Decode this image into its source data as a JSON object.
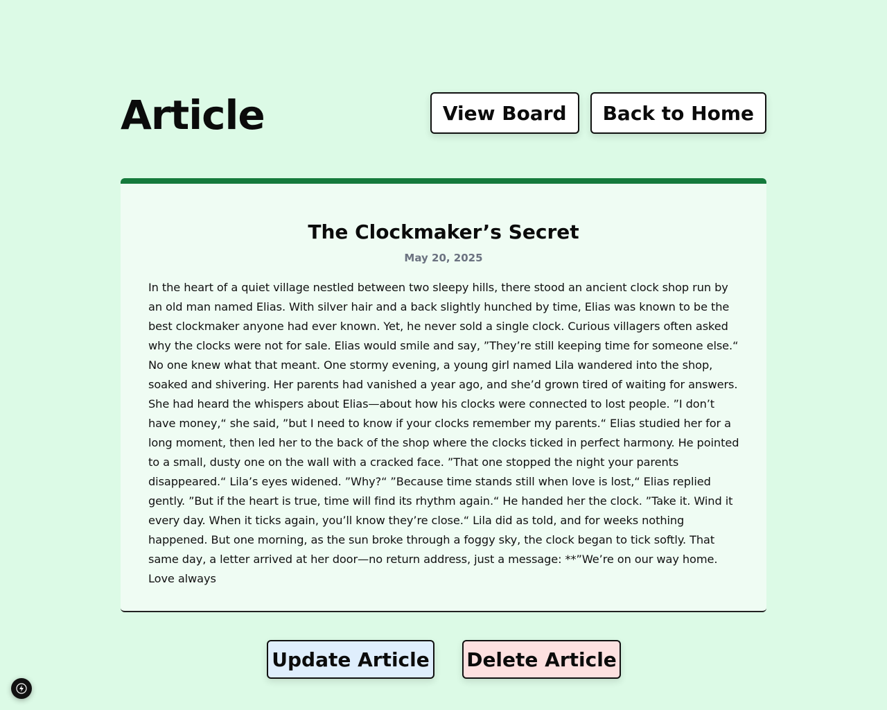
{
  "header": {
    "title": "Article",
    "view_board_label": "View Board",
    "back_home_label": "Back to Home"
  },
  "article": {
    "title": "The Clockmaker’s Secret",
    "date": "May 20, 2025",
    "body": "In the heart of a quiet village nestled between two sleepy hills, there stood an ancient clock shop run by an old man named Elias. With silver hair and a back slightly hunched by time, Elias was known to be the best clockmaker anyone had ever known. Yet, he never sold a single clock. Curious villagers often asked why the clocks were not for sale. Elias would smile and say, ”They’re still keeping time for someone else.“ No one knew what that meant. One stormy evening, a young girl named Lila wandered into the shop, soaked and shivering. Her parents had vanished a year ago, and she’d grown tired of waiting for answers. She had heard the whispers about Elias—about how his clocks were connected to lost people. ”I don’t have money,“ she said, ”but I need to know if your clocks remember my parents.“ Elias studied her for a long moment, then led her to the back of the shop where the clocks ticked in perfect harmony. He pointed to a small, dusty one on the wall with a cracked face. ”That one stopped the night your parents disappeared.“ Lila’s eyes widened. ”Why?“ ”Because time stands still when love is lost,“ Elias replied gently. ”But if the heart is true, time will find its rhythm again.“ He handed her the clock. ”Take it. Wind it every day. When it ticks again, you’ll know they’re close.“ Lila did as told, and for weeks nothing happened. But one morning, as the sun broke through a foggy sky, the clock began to tick softly. That same day, a letter arrived at her door—no return address, just a message: **”We’re on our way home. Love always"
  },
  "actions": {
    "update_label": "Update Article",
    "delete_label": "Delete Article"
  },
  "dev_badge": {
    "icon": "lightning-icon"
  },
  "colors": {
    "background": "#dcfae6",
    "card": "#effcf3",
    "accent": "#157a3c",
    "update_button": "#dfeefc",
    "delete_button": "#fde0e0"
  }
}
